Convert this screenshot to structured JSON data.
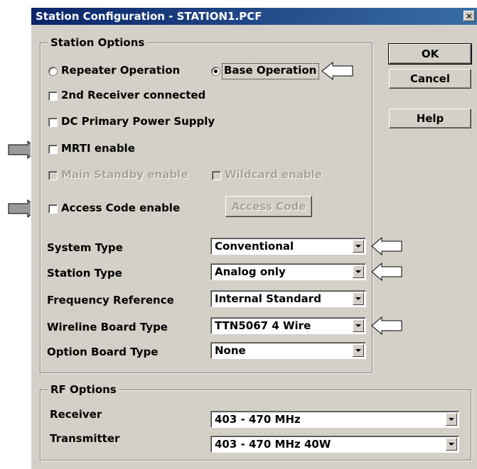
{
  "window": {
    "title": "Station Configuration - STATION1.PCF",
    "close_icon": "close-icon"
  },
  "station_options": {
    "legend": "Station Options",
    "repeater_label": "Repeater Operation",
    "base_label": "Base Operation",
    "second_receiver_label": "2nd Receiver connected",
    "dc_power_label": "DC Primary Power Supply",
    "mrti_label": "MRTI enable",
    "main_standby_label": "Main Standby enable",
    "wildcard_label": "Wildcard enable",
    "access_code_enable_label": "Access Code enable",
    "access_code_button": "Access Code",
    "fields": [
      {
        "label": "System Type",
        "value": "Conventional"
      },
      {
        "label": "Station Type",
        "value": "Analog only"
      },
      {
        "label": "Frequency Reference",
        "value": "Internal Standard"
      },
      {
        "label": "Wireline Board Type",
        "value": "TTN5067  4 Wire"
      },
      {
        "label": "Option Board Type",
        "value": "None"
      }
    ]
  },
  "rf_options": {
    "legend": "RF Options",
    "receiver_label": "Receiver",
    "receiver_value": "403 - 470 MHz",
    "transmitter_label": "Transmitter",
    "transmitter_value": "403 - 470 MHz  40W"
  },
  "buttons": {
    "ok": "OK",
    "cancel": "Cancel",
    "help": "Help"
  },
  "colors": {
    "dialog_bg": "#d4d0c8",
    "titlebar": "#0a246a",
    "callout_arrow_gray": "#9a9a9a",
    "callout_arrow_white": "#ffffff"
  }
}
